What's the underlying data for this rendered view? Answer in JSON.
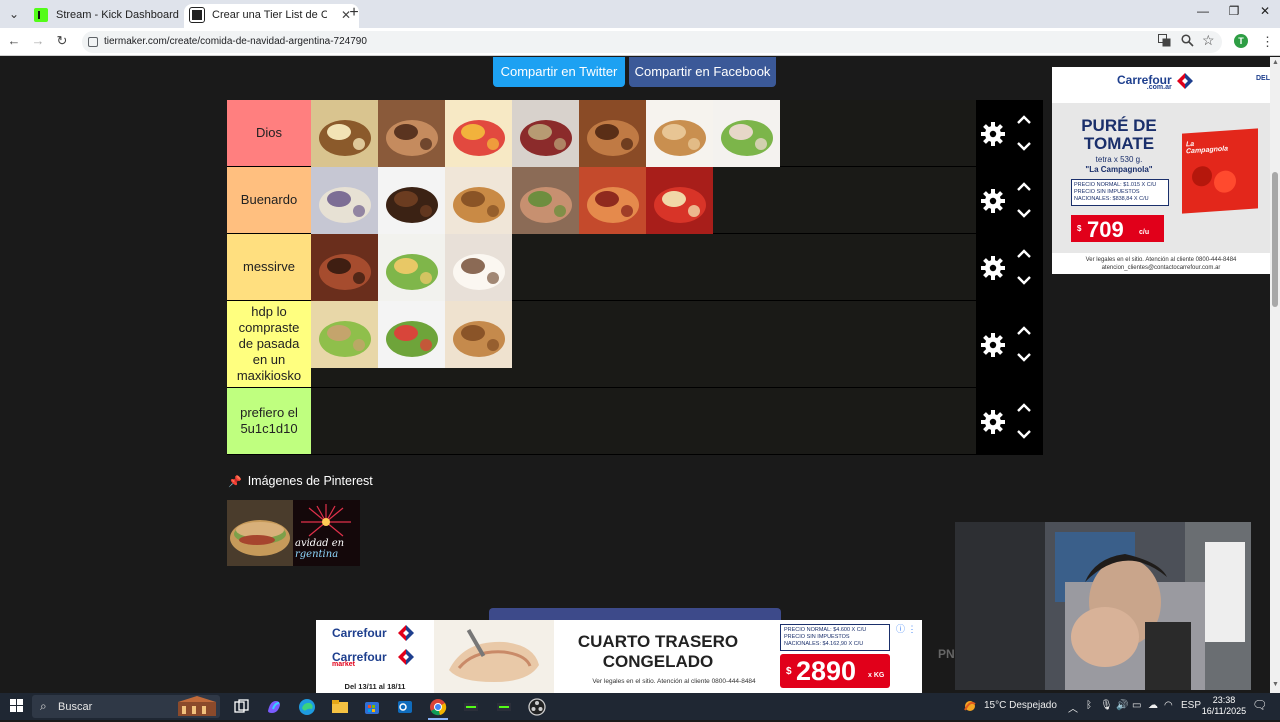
{
  "browser": {
    "tabs": [
      {
        "title": "Stream - Kick Dashboard",
        "active": false
      },
      {
        "title": "Crear una Tier List de Comida de Navidad Argentina",
        "active": true
      }
    ],
    "url": "tiermaker.com/create/comida-de-navidad-argentina-724790",
    "profile_initial": "T"
  },
  "share": {
    "twitter": "Compartir en Twitter",
    "facebook": "Compartir en Facebook"
  },
  "tiers": [
    {
      "label": "Dios",
      "color": "#ff7f7f",
      "items": [
        "turron-mantecol",
        "pan-dulce",
        "ensalada-de-frutas",
        "turron-envuelto",
        "garrapinadas",
        "budin",
        "vitel-tone"
      ]
    },
    {
      "label": "Buenardo",
      "color": "#ffbf7f",
      "items": [
        "arrollado",
        "confites-de-chocolate",
        "pionono",
        "matambre",
        "lechon",
        "tomates-rellenos"
      ]
    },
    {
      "label": "messirve",
      "color": "#ffdf7f",
      "items": [
        "costillas",
        "ensalada-rusa",
        "turron-blanco"
      ]
    },
    {
      "label": "hdp lo compraste de pasada en un maxikiosko",
      "color": "#ffff7f",
      "items": [
        "sandwich-de-miga",
        "ensalada-verde",
        "pan-dulce-simple"
      ]
    },
    {
      "label": "prefiero el 5u1c1d10",
      "color": "#bfff7f",
      "items": []
    }
  ],
  "pinterest": {
    "heading": "Imágenes de Pinterest",
    "image_text_1": "avidad en",
    "image_text_2": "rgentina"
  },
  "ad_right": {
    "brand": "Carrefour",
    "brand_sub": ".com.ar",
    "corner": "DEL",
    "title": "PURÉ DE TOMATE",
    "subtitle": "tetra x 530 g.",
    "product": "\"La Campagnola\"",
    "precio_normal": "PRECIO NORMAL: $1.015 X C/U",
    "precio_sin_impuestos": "PRECIO SIN IMPUESTOS",
    "precio_nacionales": "NACIONALES: $838,84 X C/U",
    "price": "709",
    "price_currency": "$",
    "price_unit": "c/u",
    "box_label": "La Campagnola",
    "legal": "Ver legales en el sitio. Atención al cliente 0800-444-8484",
    "email": "atencion_clientes@contactocarrefour.com.ar"
  },
  "ad_bottom": {
    "brand_1": "Carrefour",
    "brand_2": "Carrefour",
    "brand_2_sub": "market",
    "dates": "Del 13/11 al 18/11",
    "headline_1": "CUARTO TRASERO",
    "headline_2": "CONGELADO",
    "legal": "Ver legales en el sitio. Atención al cliente 0800-444-8484",
    "precio_normal": "PRECIO NORMAL: $4.600 X C/U",
    "precio_sin_impuestos": "PRECIO SIN IMPUESTOS",
    "precio_nacionales": "NACIONALES: $4.162,90 X C/U",
    "price": "2890",
    "price_currency": "$",
    "price_unit": "x KG"
  },
  "overlay": {
    "pn_text": "PN"
  },
  "taskbar": {
    "search_placeholder": "Buscar",
    "weather": "15°C  Despejado",
    "language": "ESP",
    "time": "23:38",
    "date": "16/11/2025"
  }
}
